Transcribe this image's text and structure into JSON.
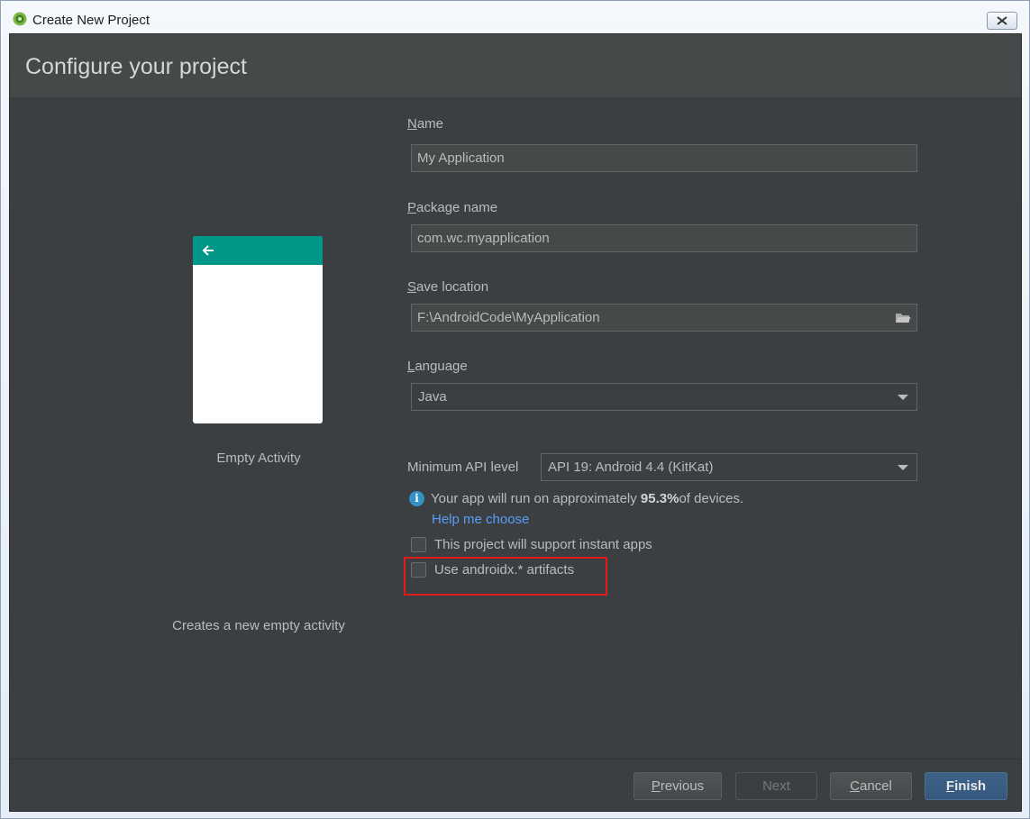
{
  "window": {
    "title": "Create New Project"
  },
  "header": {
    "title": "Configure your project"
  },
  "template": {
    "name": "Empty Activity",
    "description": "Creates a new empty activity"
  },
  "form": {
    "name": {
      "label_mnemonic": "N",
      "label_rest": "ame",
      "value": "My Application"
    },
    "package": {
      "label_mnemonic": "P",
      "label_rest": "ackage name",
      "value": "com.wc.myapplication"
    },
    "location": {
      "label_mnemonic": "S",
      "label_rest": "ave location",
      "value": "F:\\AndroidCode\\MyApplication"
    },
    "language": {
      "label_mnemonic": "L",
      "label_rest": "anguage",
      "value": "Java"
    },
    "min_api": {
      "label": "Minimum API level",
      "value": "API 19: Android 4.4 (KitKat)"
    },
    "info": {
      "prefix": "Your app will run on approximately ",
      "percent": "95.3%",
      "suffix": " of devices."
    },
    "help_link": "Help me choose",
    "instant_apps": {
      "label": "This project will support instant apps",
      "checked": false
    },
    "androidx": {
      "label": "Use androidx.* artifacts",
      "checked": false
    }
  },
  "buttons": {
    "previous": {
      "mnemonic": "P",
      "rest": "revious"
    },
    "next": "Next",
    "cancel": {
      "mnemonic": "C",
      "rest": "ancel"
    },
    "finish": {
      "mnemonic": "F",
      "rest": "inish"
    }
  },
  "colors": {
    "accent_teal": "#009688",
    "link_blue": "#589df6",
    "highlight_red": "#e21c1c",
    "primary_button": "#365880"
  }
}
